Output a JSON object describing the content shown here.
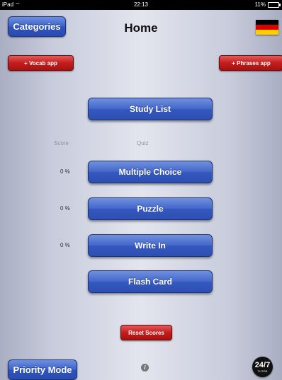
{
  "status_bar": {
    "device": "iPad",
    "wifi_icon": "wifi-icon",
    "time": "22:13",
    "battery": "11%"
  },
  "header": {
    "title": "Home",
    "categories_label": "Categories",
    "flag": "german-flag-icon"
  },
  "top_links": {
    "vocab_label": "+ Vocab app",
    "phrases_label": "+ Phrases app"
  },
  "study_list_label": "Study List",
  "columns": {
    "score": "Score",
    "quiz": "Quiz"
  },
  "quizzes": [
    {
      "label": "Multiple Choice",
      "score": "0 %"
    },
    {
      "label": "Puzzle",
      "score": "0 %"
    },
    {
      "label": "Write In",
      "score": "0 %"
    },
    {
      "label": "Flash Card"
    }
  ],
  "reset_label": "Reset Scores",
  "footer": {
    "priority_label": "Priority Mode",
    "info_icon": "i",
    "logo_big": "24/7",
    "logo_small": "TUTOR"
  },
  "colors": {
    "flag_black": "#000000",
    "flag_red": "#dd0000",
    "flag_gold": "#ffce00",
    "blue_button": "#3458bf",
    "red_button": "#c41d1d"
  }
}
